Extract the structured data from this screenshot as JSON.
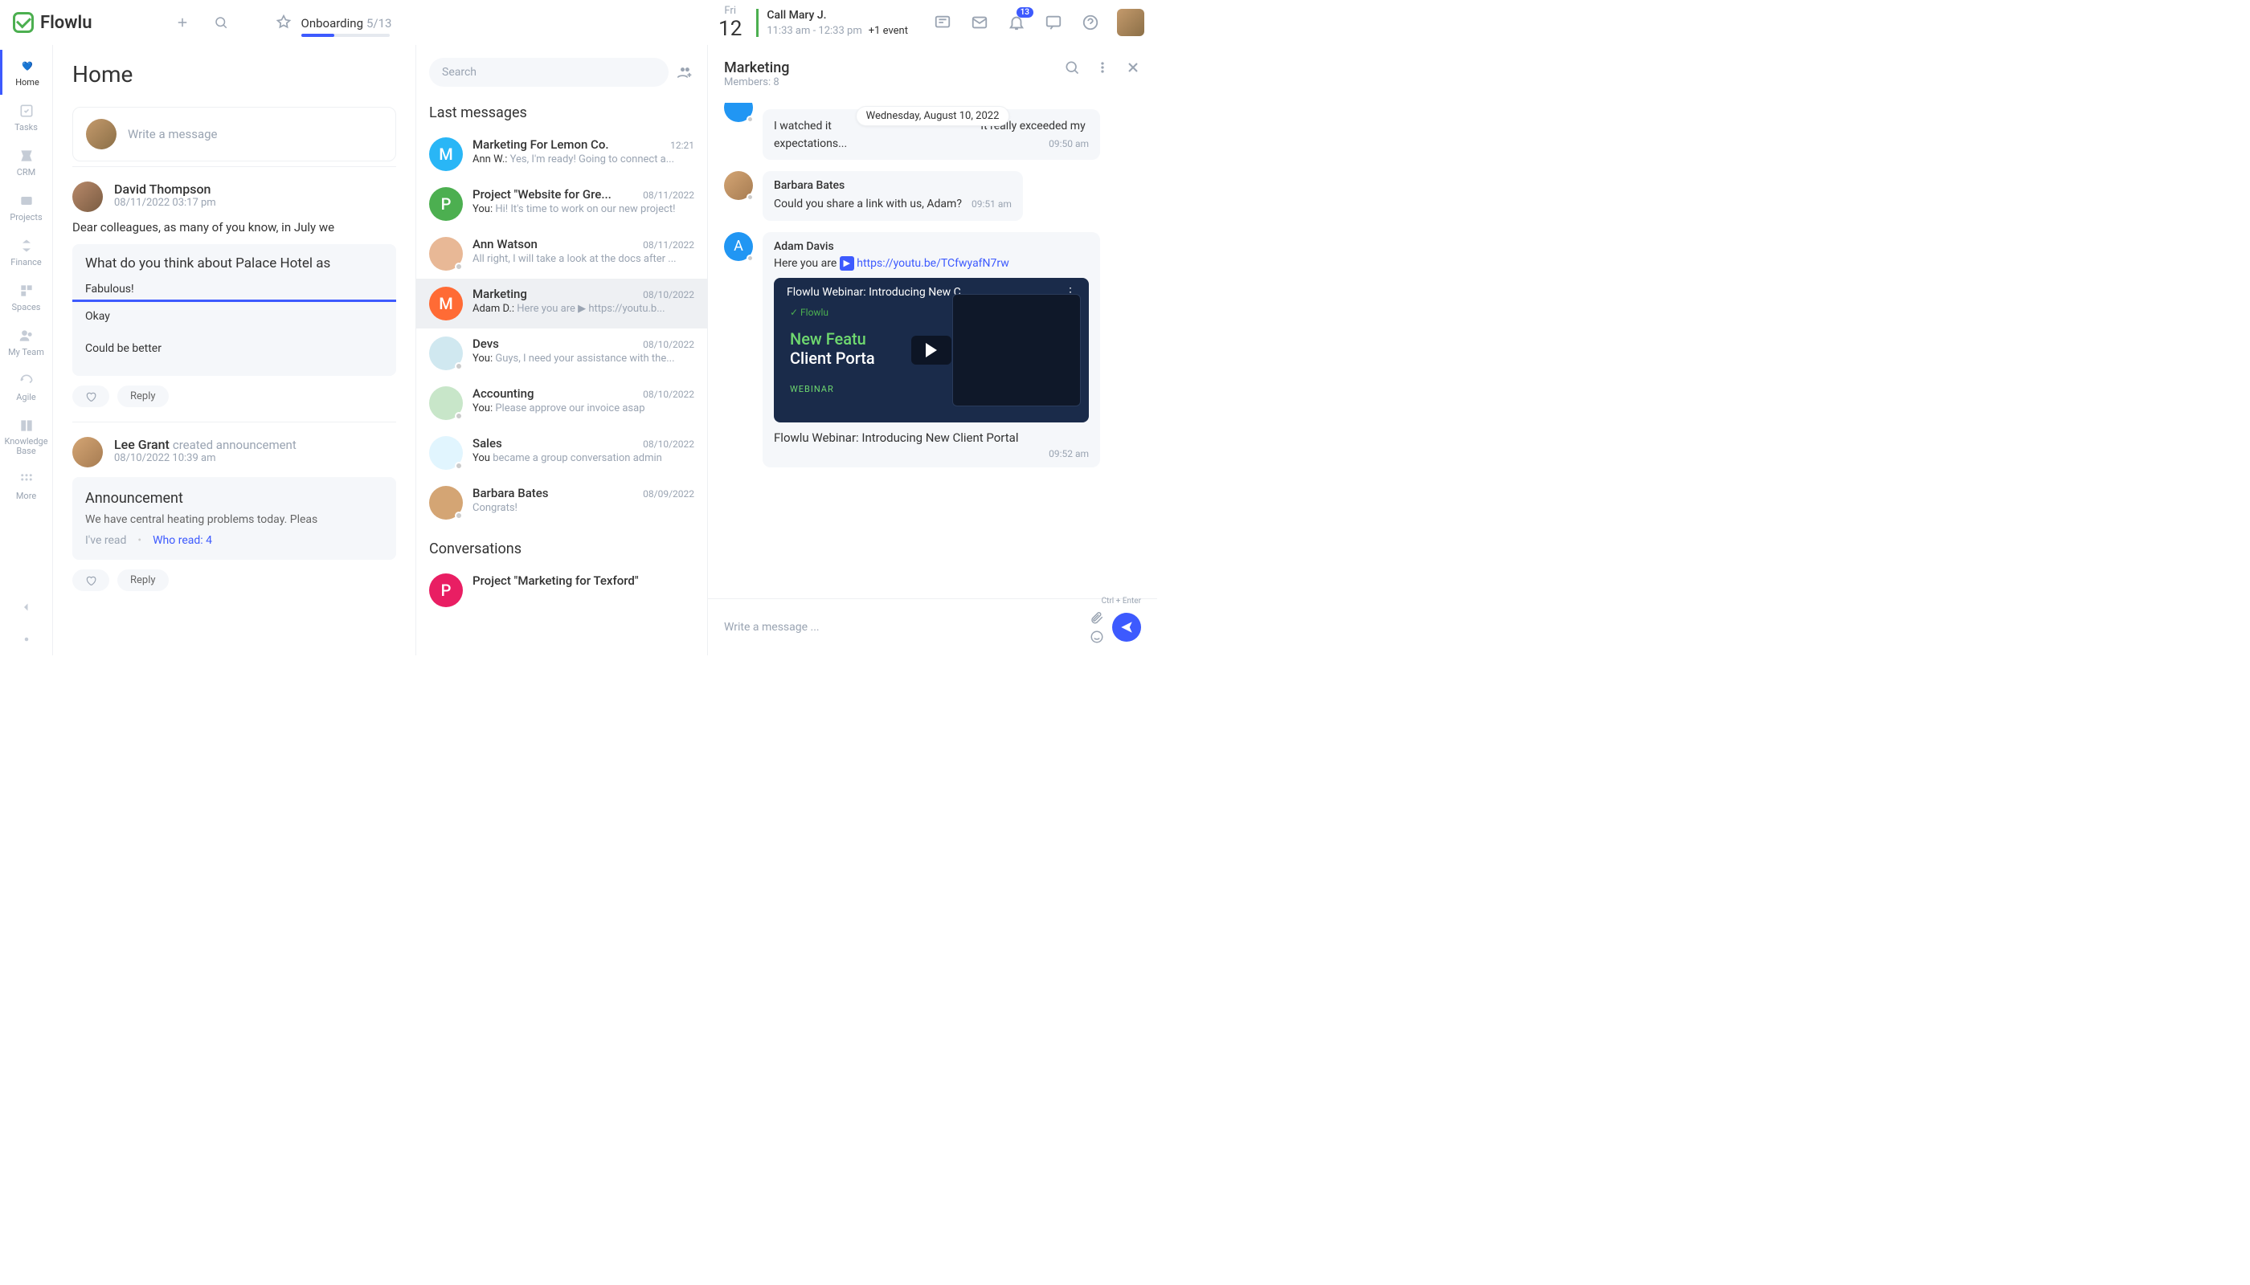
{
  "brand": "Flowlu",
  "onboarding": {
    "label": "Onboarding",
    "count": "5/13",
    "progress_pct": 38
  },
  "calendar": {
    "day_short": "Fri",
    "day_num": "12",
    "event_title": "Call Mary J.",
    "event_time": "11:33 am - 12:33 pm",
    "more": "+1 event"
  },
  "notif_badge": "13",
  "sidebar": {
    "items": [
      {
        "label": "Home"
      },
      {
        "label": "Tasks"
      },
      {
        "label": "CRM"
      },
      {
        "label": "Projects"
      },
      {
        "label": "Finance"
      },
      {
        "label": "Spaces"
      },
      {
        "label": "My Team"
      },
      {
        "label": "Agile"
      },
      {
        "label": "Knowledge Base"
      },
      {
        "label": "More"
      }
    ]
  },
  "feed": {
    "title": "Home",
    "compose_placeholder": "Write a message",
    "posts": [
      {
        "author": "David Thompson",
        "meta": "08/11/2022 03:17 pm",
        "body": "Dear colleagues, as many of you know, in July we",
        "poll": {
          "question": "What do you think about Palace Hotel as",
          "options": [
            {
              "label": "Fabulous!",
              "selected": true
            },
            {
              "label": "Okay"
            },
            {
              "label": "Could be better"
            }
          ]
        },
        "reply": "Reply"
      },
      {
        "author": "Lee Grant",
        "verb": "created announcement",
        "meta": "08/10/2022 10:39 am",
        "announcement": {
          "title": "Announcement",
          "text": "We have central heating problems today. Pleas",
          "read": "I've read",
          "who_read": "Who read: 4"
        },
        "reply": "Reply"
      }
    ]
  },
  "middle": {
    "search_placeholder": "Search",
    "section1": "Last messages",
    "convs": [
      {
        "name": "Marketing For Lemon Co.",
        "date": "12:21",
        "who": "Ann W.:",
        "prev": "Yes, I'm ready! Going to connect a...",
        "color": "#29b6f6",
        "initial": "M"
      },
      {
        "name": "Project \"Website for Gre...",
        "date": "08/11/2022",
        "who": "You:",
        "prev": "Hi! It's time to work on our new project!",
        "color": "#4caf50",
        "initial": "P"
      },
      {
        "name": "Ann Watson",
        "date": "08/11/2022",
        "who": "",
        "prev": "All right, I will take a look at the docs after ...",
        "avatar": "#e8b896"
      },
      {
        "name": "Marketing",
        "date": "08/10/2022",
        "who": "Adam D.:",
        "prev": "Here you are ▶ https://youtu.b...",
        "color": "#ff6b35",
        "initial": "M",
        "active": true
      },
      {
        "name": "Devs",
        "date": "08/10/2022",
        "who": "You:",
        "prev": "Guys, I need your assistance with the...",
        "avatar": "#d0e8f0"
      },
      {
        "name": "Accounting",
        "date": "08/10/2022",
        "who": "You:",
        "prev": "Please approve our invoice asap",
        "avatar": "#c8e6c9"
      },
      {
        "name": "Sales",
        "date": "08/10/2022",
        "who": "You ",
        "prev": "became a group conversation admin",
        "avatar": "#e1f5fe"
      },
      {
        "name": "Barbara Bates",
        "date": "08/09/2022",
        "who": "",
        "prev": "Congrats!",
        "avatar": "#d4a574"
      }
    ],
    "section2": "Conversations",
    "conv2": {
      "name": "Project \"Marketing for Texford\"",
      "color": "#e91e63",
      "initial": "P"
    }
  },
  "chat": {
    "title": "Marketing",
    "subtitle": "Members: 8",
    "date_chip": "Wednesday, August 10, 2022",
    "messages": [
      {
        "text_a": "I watched it ",
        "text_b": " It really exceeded my expectations...",
        "time": "09:50 am",
        "partial": true
      },
      {
        "name": "Barbara Bates",
        "text": "Could you share a link with us, Adam?",
        "time": "09:51 am",
        "avatar": "#d4a574"
      },
      {
        "name": "Adam Davis",
        "text": "Here you are ",
        "link": "https://youtu.be/TCfwyafN7rw",
        "time": "09:52 am",
        "color": "#2196f3",
        "initial": "A",
        "video": {
          "overlay": "Flowlu Webinar: Introducing New C...",
          "feat": "New Featu",
          "sub": "Client Porta",
          "tag": "WEBINAR",
          "logo": "Flowlu"
        },
        "video_desc": "Flowlu Webinar: Introducing New Client Portal"
      }
    ],
    "input_placeholder": "Write a message ...",
    "kbd_hint": "Ctrl + Enter"
  }
}
